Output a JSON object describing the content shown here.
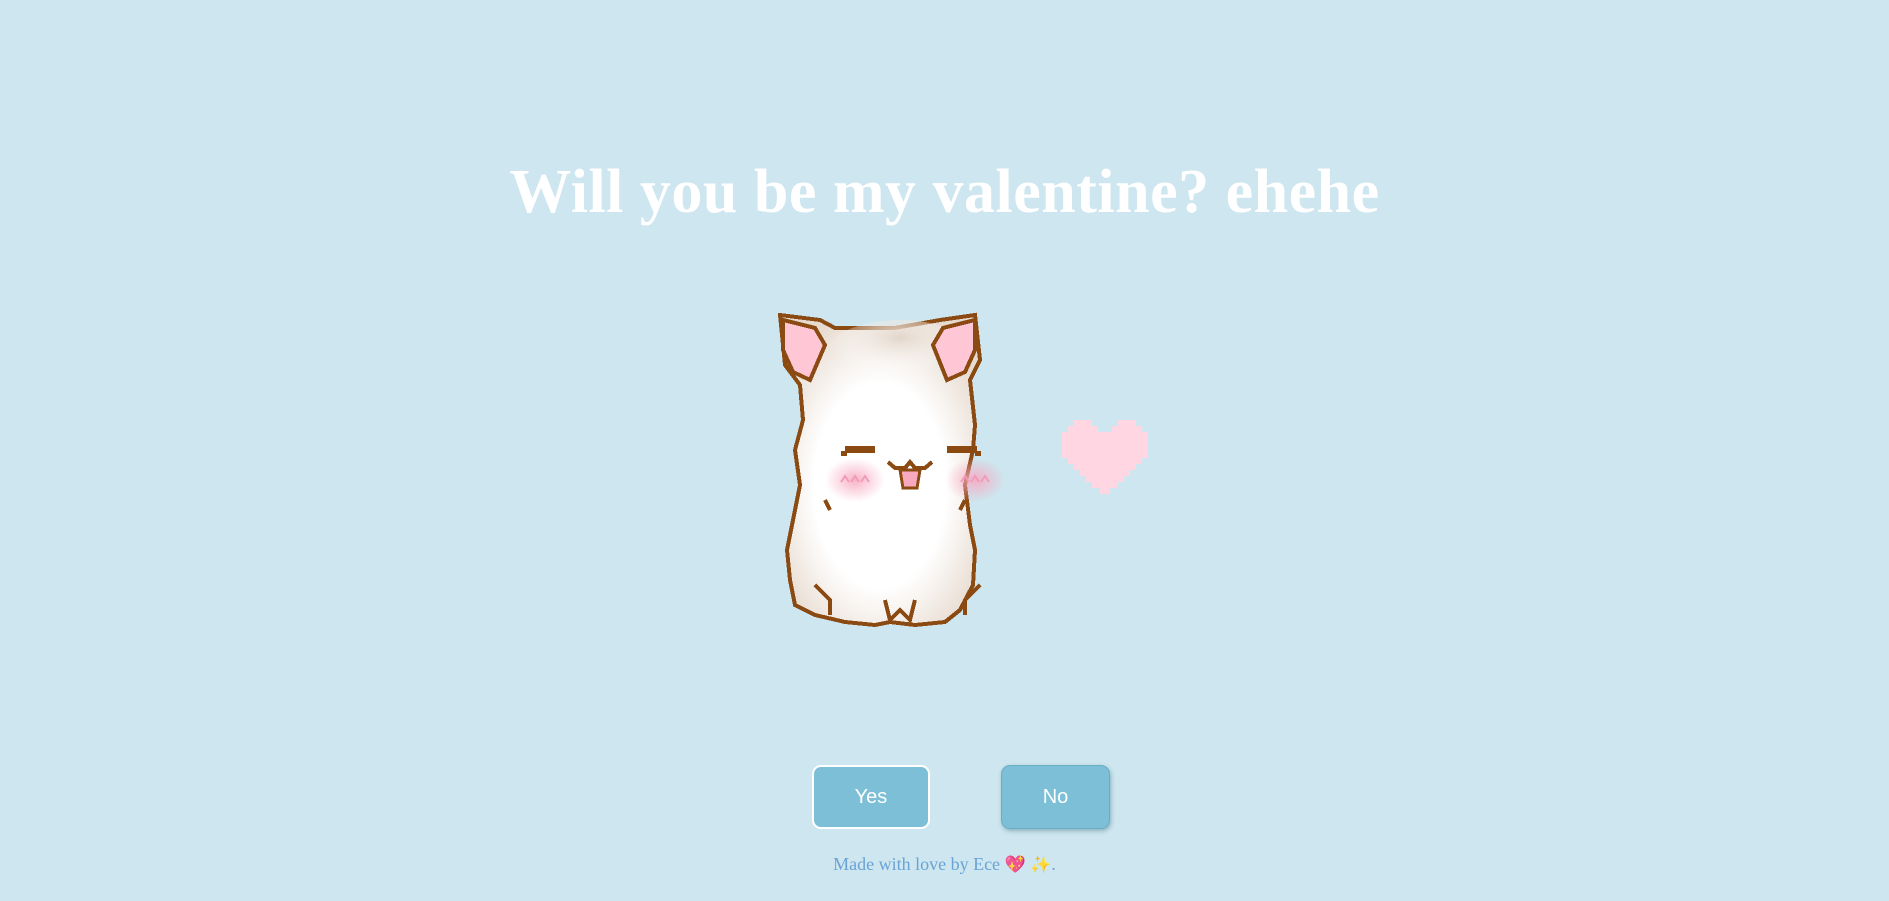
{
  "page": {
    "title": "Will you be my valentine? ehehe"
  },
  "illustration": {
    "cat": "pixel-cat-icon",
    "heart": "pixel-heart-icon"
  },
  "buttons": {
    "yes_label": "Yes",
    "no_label": "No"
  },
  "footer": {
    "text": "Made with love by Ece",
    "heart_emoji": "💖",
    "sparkle_emoji": "✨",
    "end": "."
  },
  "colors": {
    "background": "#cde6ef",
    "button": "#7dbfd6",
    "footer_text": "#6aa3d5",
    "title": "#ffffff"
  }
}
